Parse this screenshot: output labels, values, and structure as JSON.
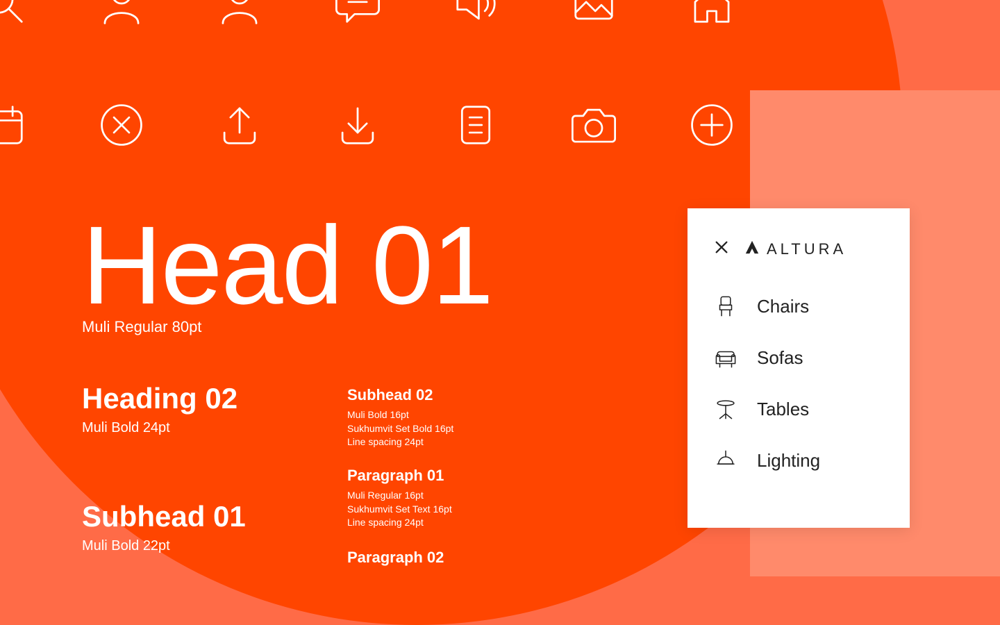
{
  "typography": {
    "head01": {
      "label": "Head 01",
      "spec": "Muli Regular 80pt"
    },
    "heading02": {
      "label": "Heading 02",
      "spec": "Muli Bold 24pt"
    },
    "subhead01": {
      "label": "Subhead 01",
      "spec": "Muli Bold 22pt"
    },
    "subhead02": {
      "label": "Subhead 02",
      "spec": "Muli Bold 16pt\nSukhumvit Set Bold 16pt\nLine spacing 24pt"
    },
    "paragraph01": {
      "label": "Paragraph 01",
      "spec": "Muli Regular 16pt\nSukhumvit Set Text 16pt\nLine spacing 24pt"
    },
    "paragraph02": {
      "label": "Paragraph 02"
    }
  },
  "menu": {
    "brand": "ALTURA",
    "items": [
      {
        "label": "Chairs"
      },
      {
        "label": "Sofas"
      },
      {
        "label": "Tables"
      },
      {
        "label": "Lighting"
      }
    ]
  },
  "colors": {
    "brand_orange": "#ff4500",
    "brand_light": "#ff6b47",
    "brand_lighter": "#ff8a6b"
  }
}
